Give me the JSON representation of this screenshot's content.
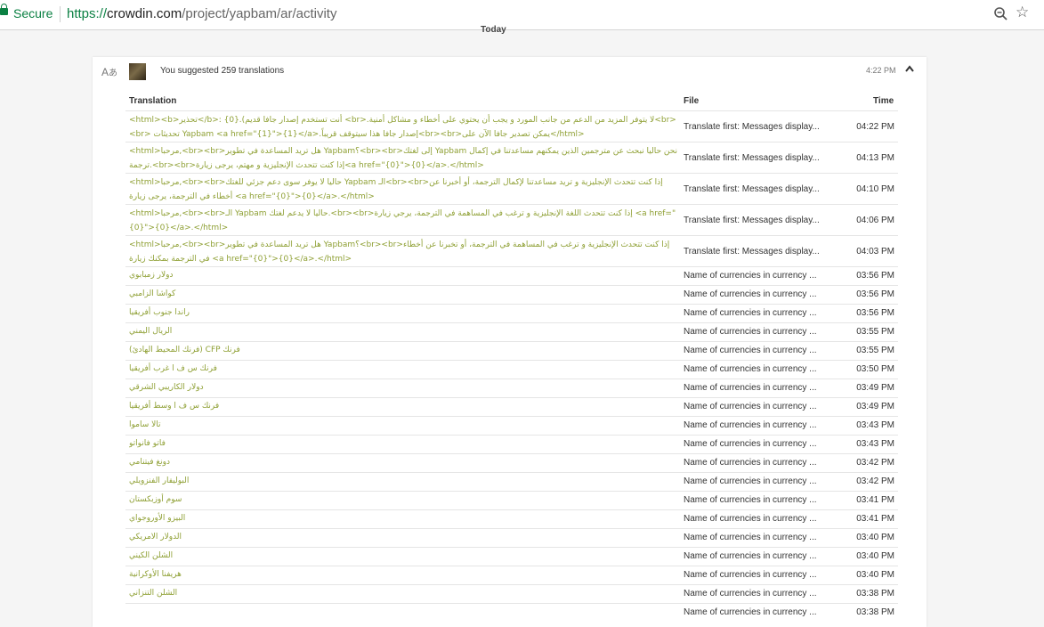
{
  "browser": {
    "secure_label": "Secure",
    "url_proto": "https://",
    "url_host": "crowdin.com",
    "url_path": "/project/yapbam/ar/activity"
  },
  "day_label": "Today",
  "activity": {
    "summary": "You suggested 259 translations",
    "time": "4:22 PM",
    "columns": {
      "translation": "Translation",
      "file": "File",
      "time": "Time"
    },
    "rows": [
      {
        "translation": "<html><b>تحذير</b>: {0}.(أنت تستخدم إصدار جافا قديم <br>.لا يتوفر المزيد من الدعم من جانب المورد و يجب أن يحتوي على أخطاء و مشاكل أمنية<br><br> تحديثات Yapbam <a href=\"{1}\">{1}</a>.إصدار جافا هذا سيتوقف قريباً<br><br>يمكن تصدير جافا الآن على</html>",
        "file": "Translate first: Messages display...",
        "time": "04:22 PM",
        "tall": true
      },
      {
        "translation": "<html>مرحبا,<br><br>هل تريد المساعدة في تطوير Yapbam؟<br><br>إلى لغتك Yapbam نحن حاليا نبحث عن مترجمين الذين يمكنهم مساعدتنا في إكمال ترجمة.<br><br>إذا كنت تتحدث الإنجليزية و مهتم، يرجى زيارة<a href=\"{0}\">{0}</a>.</html>",
        "file": "Translate first: Messages display...",
        "time": "04:13 PM",
        "tall": true
      },
      {
        "translation": "<html>مرحبا,<br><br>حاليا لا يوفر سوى دعم جزئي للغتك Yapbam الـ<br><br>إذا كنت تتحدث الإنجليزية و تريد مساعدتنا لإكمال الترجمة، أو أخبرنا عن أخطاء في الترجمة، يرجى زيارة <a href=\"{0}\">{0}</a>.</html>",
        "file": "Translate first: Messages display...",
        "time": "04:10 PM",
        "tall": true
      },
      {
        "translation": "<html>مرحبا,<br><br>الـ Yapbam حاليا لا يدعم لغتك.<br><br>إذا كنت تتحدث اللغة الإنجليزية و ترغب في المساهمة في الترجمة، يرجي زيارة <a href=\"{0}\">{0}</a>.</html>",
        "file": "Translate first: Messages display...",
        "time": "04:06 PM",
        "tall": true
      },
      {
        "translation": "<html>مرحبا,<br><br>هل تريد المساعدة في تطوير Yapbam؟<br><br>إذا كنت تتحدث الإنجليزية و ترغب في المساهمة في الترجمة، أو تخبرنا عن أخطاء في الترجمة بمكنك زيارة <a href=\"{0}\">{0}</a>.</html>",
        "file": "Translate first: Messages display...",
        "time": "04:03 PM",
        "tall": true
      },
      {
        "translation": "دولار زمبابوي",
        "file": "Name of currencies in currency ...",
        "time": "03:56 PM"
      },
      {
        "translation": "كواشا الزامبي",
        "file": "Name of currencies in currency ...",
        "time": "03:56 PM"
      },
      {
        "translation": "راندا جنوب أفريقيا",
        "file": "Name of currencies in currency ...",
        "time": "03:56 PM"
      },
      {
        "translation": "الريال اليمني",
        "file": "Name of currencies in currency ...",
        "time": "03:55 PM"
      },
      {
        "translation": "فرنك CFP (فرنك المحيط الهادئ)",
        "file": "Name of currencies in currency ...",
        "time": "03:55 PM"
      },
      {
        "translation": "فرنك س ف ا غرب أفريقيا",
        "file": "Name of currencies in currency ...",
        "time": "03:50 PM"
      },
      {
        "translation": "دولار الكاريبي الشرقي",
        "file": "Name of currencies in currency ...",
        "time": "03:49 PM"
      },
      {
        "translation": "فرنك س ف ا وسط أفريقيا",
        "file": "Name of currencies in currency ...",
        "time": "03:49 PM"
      },
      {
        "translation": "تالا ساموا",
        "file": "Name of currencies in currency ...",
        "time": "03:43 PM"
      },
      {
        "translation": "فاتو فانواتو",
        "file": "Name of currencies in currency ...",
        "time": "03:43 PM"
      },
      {
        "translation": "دونغ فيتنامي",
        "file": "Name of currencies in currency ...",
        "time": "03:42 PM"
      },
      {
        "translation": "البوليفار الفنزويلي",
        "file": "Name of currencies in currency ...",
        "time": "03:42 PM"
      },
      {
        "translation": "سوم أوزبكستان",
        "file": "Name of currencies in currency ...",
        "time": "03:41 PM"
      },
      {
        "translation": "البيزو الأوروجواي",
        "file": "Name of currencies in currency ...",
        "time": "03:41 PM"
      },
      {
        "translation": "الدولار الامريكي",
        "file": "Name of currencies in currency ...",
        "time": "03:40 PM"
      },
      {
        "translation": "الشلن الكيني",
        "file": "Name of currencies in currency ...",
        "time": "03:40 PM"
      },
      {
        "translation": "هريفنا الأوكرانية",
        "file": "Name of currencies in currency ...",
        "time": "03:40 PM"
      },
      {
        "translation": "الشلن التنزاني",
        "file": "Name of currencies in currency ...",
        "time": "03:38 PM"
      },
      {
        "translation": "",
        "file": "Name of currencies in currency ...",
        "time": "03:38 PM"
      }
    ]
  },
  "colors": {
    "secure_green": "#0b8043",
    "translation_text": "#8fa035"
  }
}
